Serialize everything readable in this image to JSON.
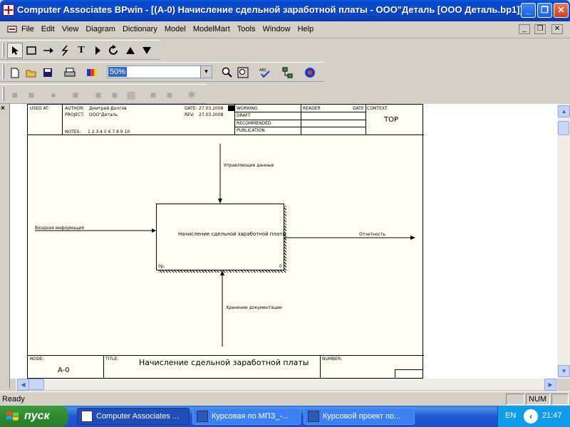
{
  "window": {
    "title": "Computer Associates BPwin - [(A-0) Начисление сдельной заработной платы - ООО\"Деталь  [ООО Деталь.bp1]]",
    "minimize_label": "_",
    "maximize_label": "❐",
    "close_label": "✕"
  },
  "menu": {
    "items": [
      "File",
      "Edit",
      "View",
      "Diagram",
      "Dictionary",
      "Model",
      "ModelMart",
      "Tools",
      "Window",
      "Help"
    ],
    "mdi_minimize": "_",
    "mdi_restore": "❐",
    "mdi_close": "✕"
  },
  "toolbar": {
    "zoom_value": "50%"
  },
  "diagram_header": {
    "used_at_label": "USED AT:",
    "author_label": "AUTHOR:",
    "author_value": "Дмитрий Долгов",
    "project_label": "PROJECT:",
    "project_value": "ООО\"Деталь",
    "date_label": "DATE:",
    "date_value": "27.03.2008",
    "rev_label": "REV:",
    "rev_value": "27.03.2008",
    "notes_label": "NOTES:",
    "notes_value": "1  2  3  4  5  6  7  8  9  10",
    "working": "WORKING",
    "draft": "DRAFT",
    "recommended": "RECOMMENDED",
    "publication": "PUBLICATION",
    "reader_label": "READER",
    "reader_date_label": "DATE",
    "context_label": "CONTEXT:",
    "context_value": "TOP"
  },
  "diagram": {
    "activity_label": "Начисление сдельной заработной платы",
    "activity_cost": "0р.",
    "activity_number": "0",
    "control_arrow": "Управляющие данные",
    "input_arrow": "Входная информация",
    "output_arrow": "Отчетность",
    "mechanism_arrow": "Хранение документации"
  },
  "diagram_footer": {
    "node_label": "NODE:",
    "node_value": "A-0",
    "title_label": "TITLE:",
    "title_value": "Начисление сдельной заработной платы",
    "number_label": "NUMBER:"
  },
  "status": {
    "ready": "Ready",
    "num": "NUM"
  },
  "taskbar": {
    "start_label": "пуск",
    "tasks": [
      "Computer Associates ...",
      "Курсовая по  МПЗ_-...",
      "Курсовой проект по..."
    ],
    "lang": "EN",
    "clock": "21:47"
  },
  "colors": {
    "title_blue": "#0a4ad0",
    "sheet_bg": "#fffef2",
    "start_green": "#2e8a2e"
  }
}
